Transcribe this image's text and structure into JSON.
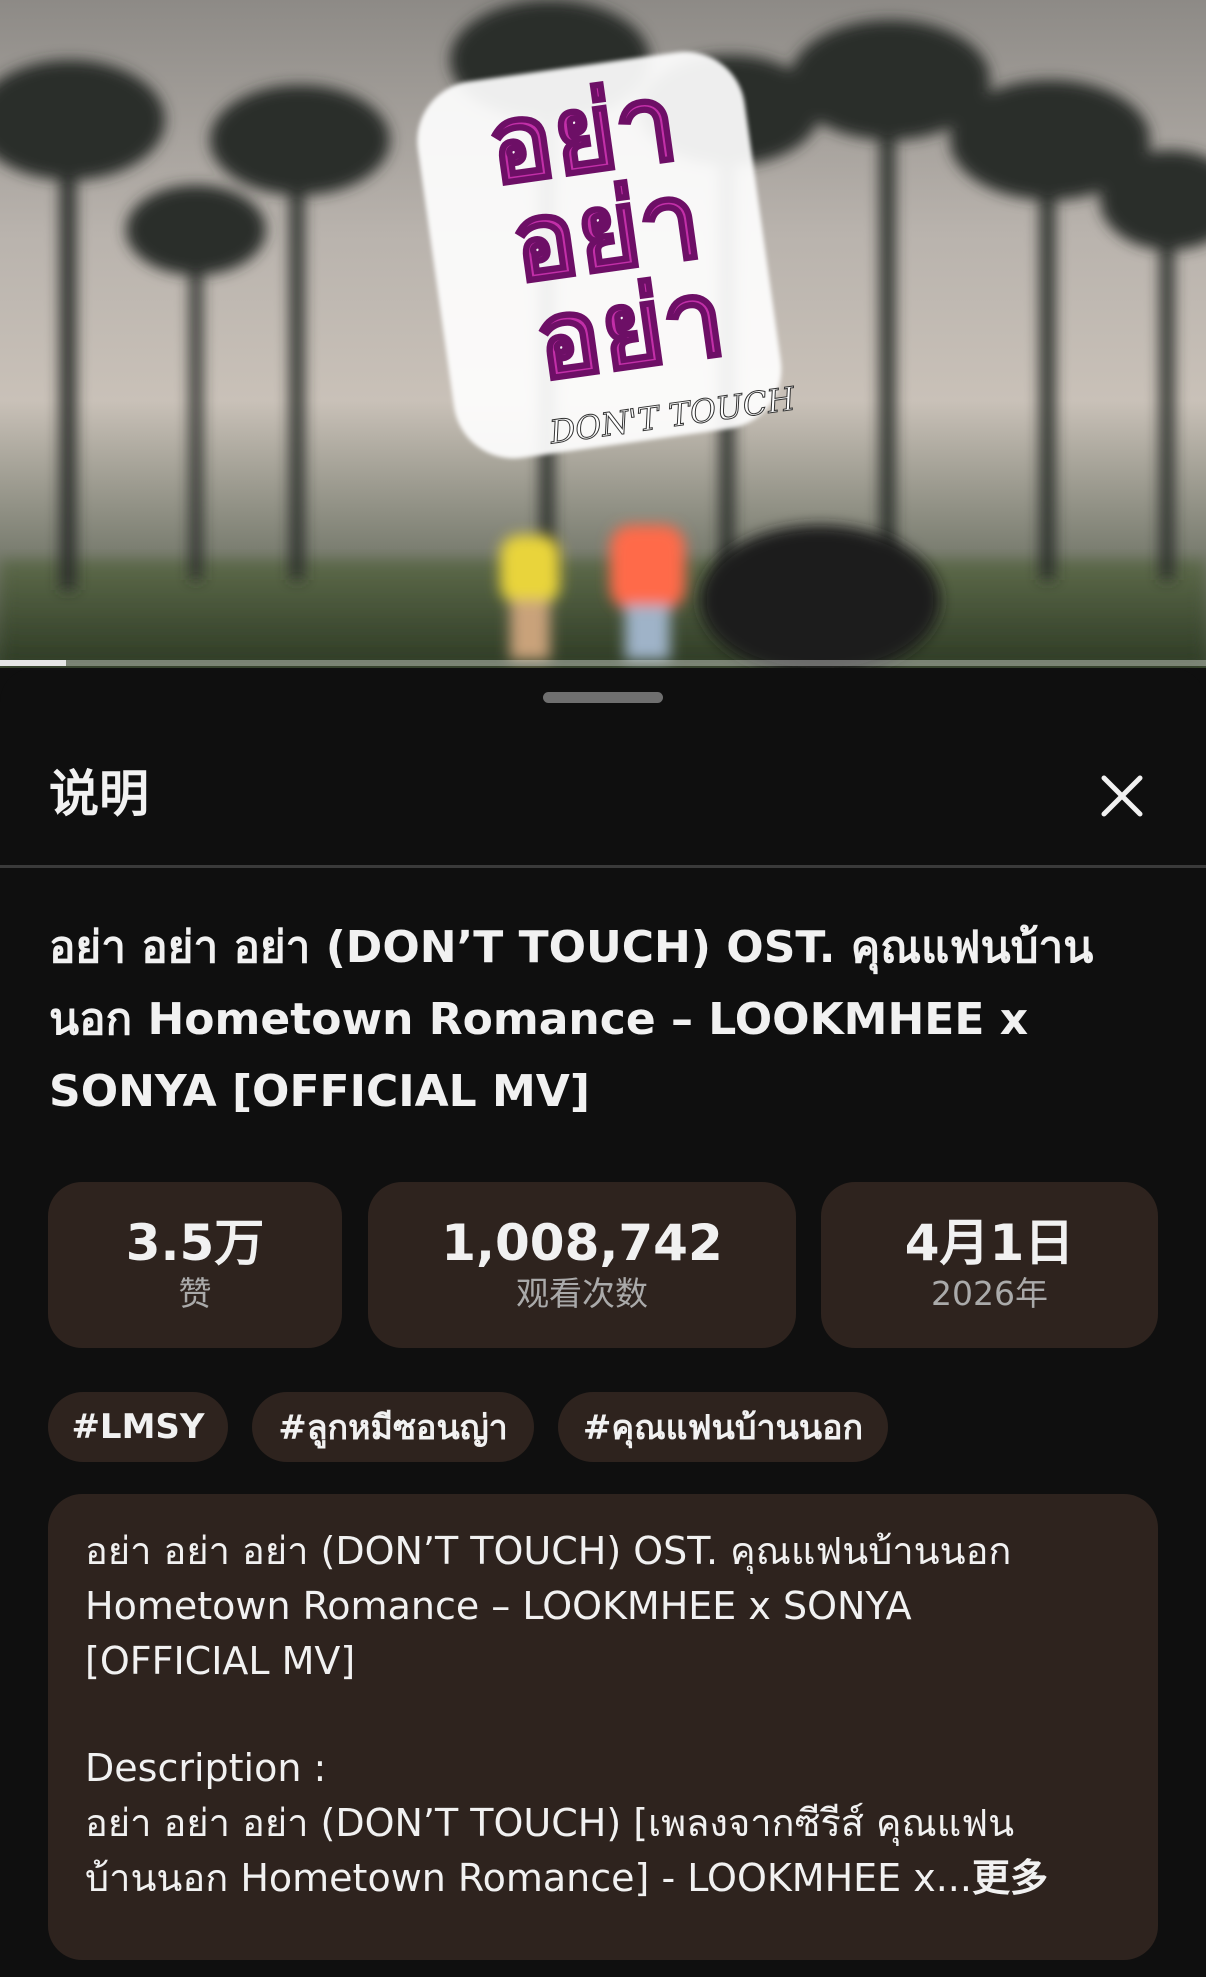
{
  "video": {
    "logo_main": "อย่า อย่า อย่า",
    "logo_sub": "DON'T TOUCH",
    "progress": 0.055
  },
  "sheet": {
    "title": "说明",
    "close_icon": "close-icon"
  },
  "video_title": "อย่า อย่า อย่า (DON’T TOUCH) OST. คุณแฟนบ้านนอก Hometown Romance – LOOKMHEE x SONYA [OFFICIAL MV]",
  "stats": [
    {
      "value": "3.5万",
      "label": "赞"
    },
    {
      "value": "1,008,742",
      "label": "观看次数"
    },
    {
      "value": "4月1日",
      "label": "2026年"
    }
  ],
  "hashtags": [
    "#LMSY",
    "#ลูกหมีซอนญ่า",
    "#คุณแฟนบ้านนอก"
  ],
  "description": {
    "line1": "อย่า อย่า อย่า (DON’T TOUCH) OST. คุณแฟนบ้านนอก",
    "line2": "Hometown Romance – LOOKMHEE x SONYA",
    "line3": "[OFFICIAL MV]",
    "line4": "Description :",
    "line5": "อย่า อย่า อย่า (DON’T TOUCH) [เพลงจากซีรีส์ คุณแฟน",
    "line6": "บ้านนอก Hometown Romance] - LOOKMHEE x...",
    "more": "更多"
  },
  "colors": {
    "background": "#0f0f0f",
    "card": "#2e231e",
    "logo_pink": "#c22fa8"
  }
}
